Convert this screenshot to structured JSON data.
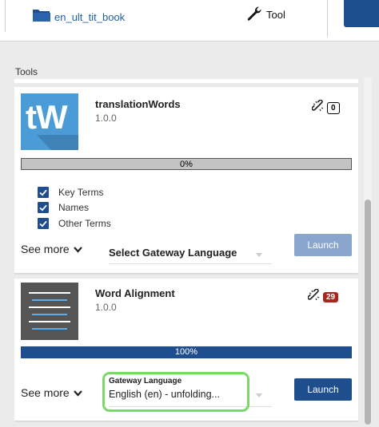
{
  "header": {
    "project_name": "en_ult_tit_book",
    "tool_label": "Tool"
  },
  "panel": {
    "section_label": "Tools"
  },
  "cards": [
    {
      "title": "translationWords",
      "version": "1.0.0",
      "thumbnail_text": "tW",
      "badge_count": "0",
      "progress_label": "0%",
      "progress_value": 0,
      "checkboxes": [
        {
          "label": "Key Terms",
          "checked": true
        },
        {
          "label": "Names",
          "checked": true
        },
        {
          "label": "Other Terms",
          "checked": true
        }
      ],
      "see_more_label": "See more",
      "gateway_select_label": "Select Gateway Language",
      "launch_label": "Launch"
    },
    {
      "title": "Word Alignment",
      "version": "1.0.0",
      "badge_count": "29",
      "progress_label": "100%",
      "progress_value": 100,
      "see_more_label": "See more",
      "gateway_label": "Gateway Language",
      "gateway_value": "English (en) - unfolding...",
      "launch_label": "Launch"
    }
  ],
  "colors": {
    "accent": "#1f4e8f",
    "link": "#1f5fa8",
    "badge_red": "#a8261d",
    "highlight": "#7dd86a",
    "tw_thumbnail": "#4a9bd6"
  }
}
